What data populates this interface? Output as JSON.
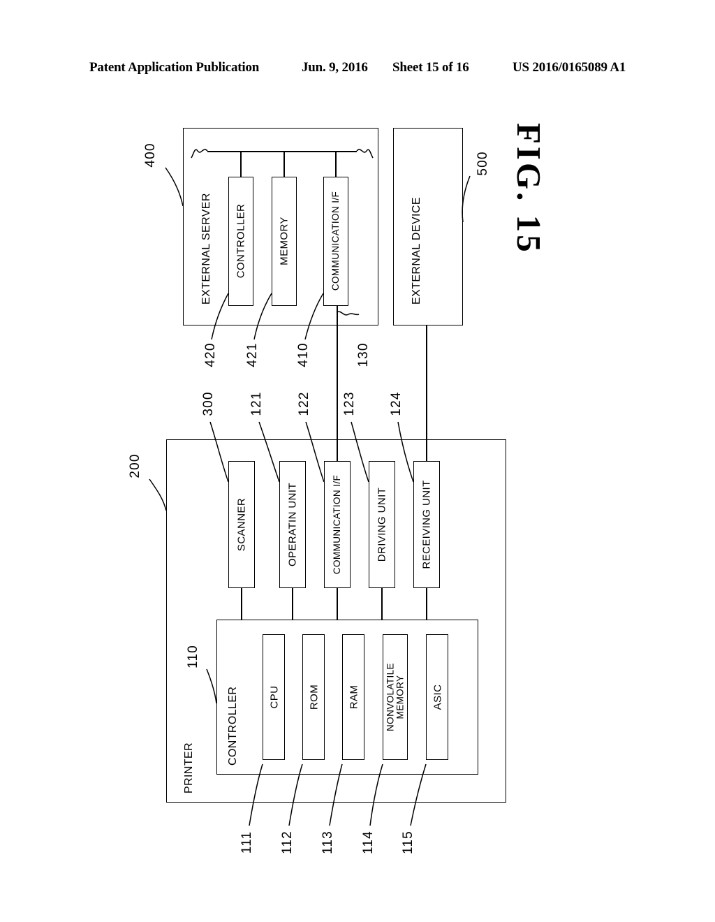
{
  "header": {
    "publication": "Patent Application Publication",
    "date": "Jun. 9, 2016",
    "sheet": "Sheet 15 of 16",
    "patent_number": "US 2016/0165089 A1"
  },
  "figure": {
    "title": "FIG. 15"
  },
  "external_server": {
    "label": "EXTERNAL SERVER",
    "ref": "400",
    "blocks": [
      {
        "label": "CONTROLLER",
        "ref": "420"
      },
      {
        "label": "MEMORY",
        "ref": "421"
      },
      {
        "label": "COMMUNICATION I/F",
        "ref": "410"
      }
    ]
  },
  "external_device": {
    "label": "EXTERNAL DEVICE",
    "ref": "500"
  },
  "network": {
    "ref": "130"
  },
  "printer": {
    "label": "PRINTER",
    "ref": "200",
    "units": [
      {
        "label": "SCANNER",
        "ref": "300"
      },
      {
        "label": "OPERATIN UNIT",
        "ref": "121"
      },
      {
        "label": "COMMUNICATION I/F",
        "ref": "122"
      },
      {
        "label": "DRIVING UNIT",
        "ref": "123"
      },
      {
        "label": "RECEIVING UNIT",
        "ref": "124"
      }
    ],
    "controller": {
      "label": "CONTROLLER",
      "ref": "110",
      "blocks": [
        {
          "label": "CPU",
          "ref": "111"
        },
        {
          "label": "ROM",
          "ref": "112"
        },
        {
          "label": "RAM",
          "ref": "113"
        },
        {
          "label_line1": "NONVOLATILE",
          "label_line2": "MEMORY",
          "ref": "114"
        },
        {
          "label": "ASIC",
          "ref": "115"
        }
      ]
    }
  }
}
